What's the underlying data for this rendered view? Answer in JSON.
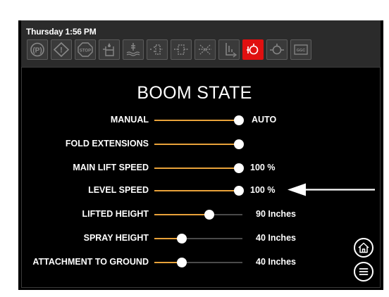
{
  "status": {
    "datetime": "Thursday 1:56 PM",
    "icons": [
      {
        "name": "parking-brake-icon",
        "text": "(P)"
      },
      {
        "name": "warning-icon",
        "text": "!"
      },
      {
        "name": "stop-icon",
        "text": "STOP"
      },
      {
        "name": "fuel-water-icon",
        "text": ""
      },
      {
        "name": "coolant-level-icon",
        "text": ""
      },
      {
        "name": "hydraulic-oil-icon",
        "text": ""
      },
      {
        "name": "hydraulic-filter-icon",
        "text": ""
      },
      {
        "name": "filter-bypass-icon",
        "text": ""
      },
      {
        "name": "boom-height-icon",
        "text": ""
      },
      {
        "name": "boom-state-icon",
        "text": "",
        "active": true
      },
      {
        "name": "oil-pressure-icon",
        "text": ""
      },
      {
        "name": "ggc-icon",
        "text": "GGC"
      }
    ]
  },
  "page": {
    "title": "BOOM STATE"
  },
  "rows": [
    {
      "label": "MANUAL",
      "value": "AUTO",
      "level": 1.0
    },
    {
      "label": "FOLD EXTENSIONS",
      "value": "",
      "level": 1.0
    },
    {
      "label": "MAIN LIFT SPEED",
      "value": "100 %",
      "level": 1.0
    },
    {
      "label": "LEVEL SPEED",
      "value": "100 %",
      "level": 1.0
    },
    {
      "label": "LIFTED HEIGHT",
      "value": "90 Inches",
      "level": 0.62
    },
    {
      "label": "SPRAY HEIGHT",
      "value": "40 Inches",
      "level": 0.31
    },
    {
      "label": "ATTACHMENT TO GROUND",
      "value": "40 Inches",
      "level": 0.31
    }
  ],
  "colors": {
    "accent": "#e8a23a",
    "active_icon": "#e01010",
    "panel": "#000000",
    "statusbar": "#2b2b2b"
  },
  "nav": {
    "home_icon": "home-icon",
    "menu_icon": "menu-icon"
  }
}
